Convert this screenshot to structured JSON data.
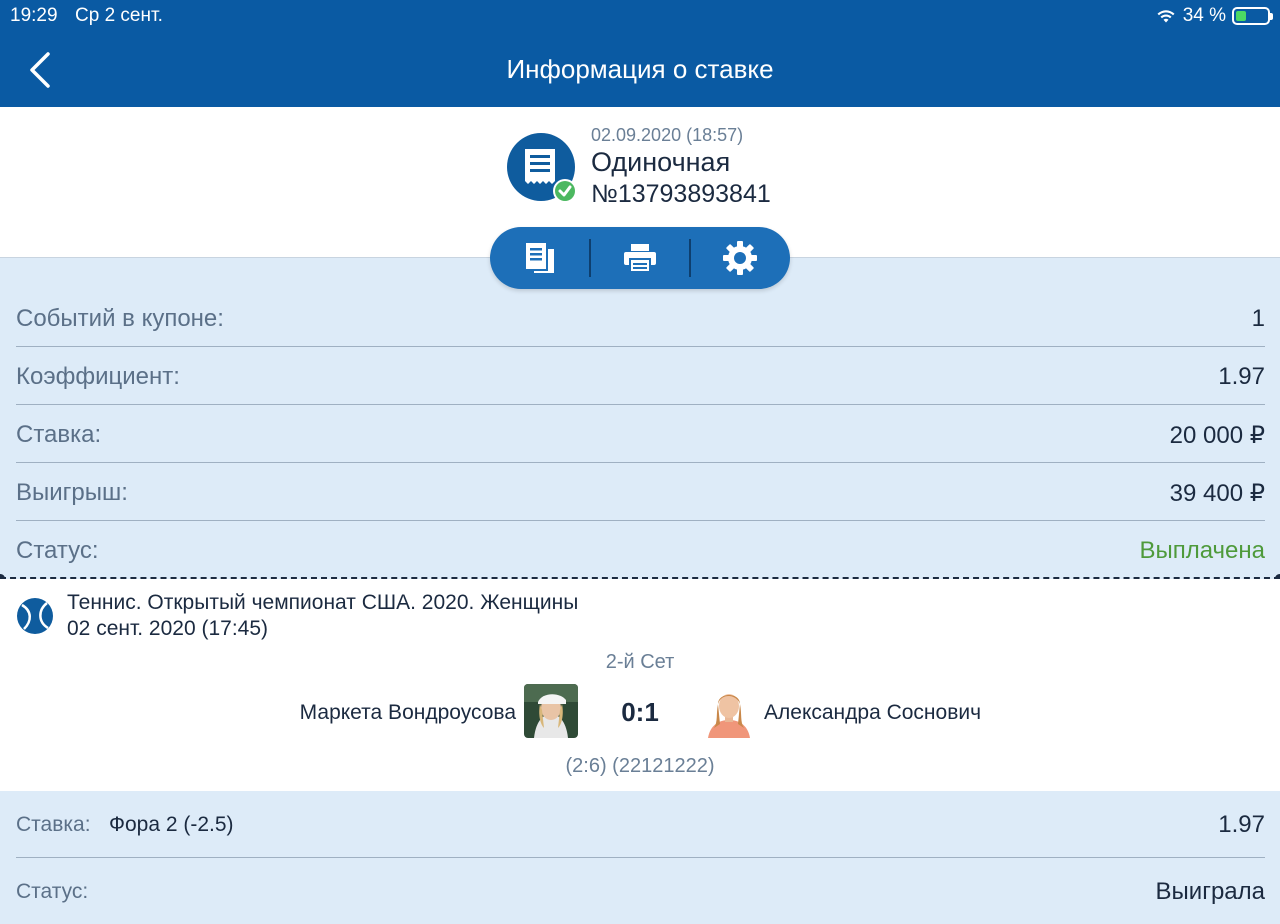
{
  "status_bar": {
    "time": "19:29",
    "date": "Ср 2 сент.",
    "battery": "34 %",
    "battery_level": 0.34
  },
  "nav": {
    "title": "Информация о ставке",
    "back_icon": "chevron-left-icon"
  },
  "bet_header": {
    "date": "02.09.2020 (18:57)",
    "type": "Одиночная",
    "number": "№13793893841",
    "icon": "receipt-check-icon"
  },
  "actions": [
    {
      "icon": "copy-document-icon"
    },
    {
      "icon": "print-icon"
    },
    {
      "icon": "settings-gear-icon"
    }
  ],
  "summary": {
    "events": {
      "label": "Событий в купоне:",
      "value": "1"
    },
    "coefficient": {
      "label": "Коэффициент:",
      "value": "1.97"
    },
    "stake": {
      "label": "Ставка:",
      "value": "20 000 ₽"
    },
    "win": {
      "label": "Выигрыш:",
      "value": "39 400 ₽"
    },
    "status": {
      "label": "Статус:",
      "value": "Выплачена",
      "color": "#4e9a3b"
    }
  },
  "event": {
    "sport_icon": "tennis-ball-icon",
    "name": "Теннис. Открытый чемпионат США. 2020. Женщины",
    "date": "02 сент. 2020 (17:45)",
    "period": "2-й Сет",
    "player1": "Маркета Вондроусова",
    "player2": "Александра Соснович",
    "score": "0:1",
    "set_scores": "(2:6) (22121222)"
  },
  "bet_detail": {
    "stake_label": "Ставка:",
    "selection": "Фора 2 (-2.5)",
    "coefficient": "1.97",
    "status_label": "Статус:",
    "status_value": "Выиграла",
    "status_color": "#4e9a3b"
  },
  "colors": {
    "primary": "#0a5aa3",
    "background": "#ddebf8",
    "success": "#4e9a3b"
  }
}
